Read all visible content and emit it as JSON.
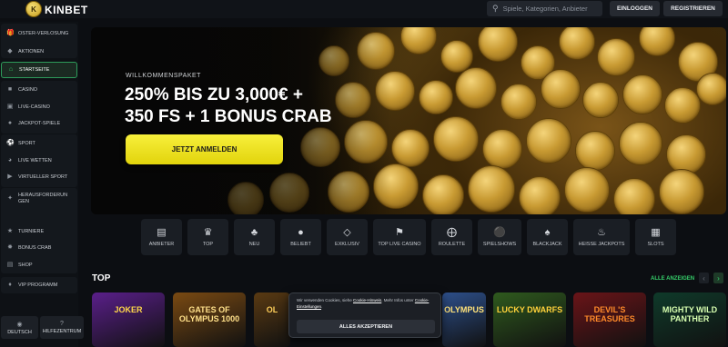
{
  "header": {
    "logo_mark": "K",
    "brand": "KINBET",
    "search_placeholder": "Spiele, Kategorien, Anbieter",
    "login_label": "EINLOGGEN",
    "register_label": "REGISTRIEREN"
  },
  "sidebar": {
    "items": [
      {
        "label": "Oster-Verlosung",
        "icon": "gift-icon"
      },
      {
        "label": "Aktionen",
        "icon": "tag-icon"
      },
      {
        "label": "Startseite",
        "icon": "home-icon",
        "active": true
      },
      {
        "label": "Casino",
        "icon": "casino-icon"
      },
      {
        "label": "Live-Casino",
        "icon": "live-casino-icon"
      },
      {
        "label": "Jackpot-Spiele",
        "icon": "jackpot-icon"
      },
      {
        "label": "Sport",
        "icon": "ball-icon"
      },
      {
        "label": "Live Wetten",
        "icon": "live-bet-icon"
      },
      {
        "label": "Virtueller Sport",
        "icon": "virtual-sport-icon"
      },
      {
        "label": "Herausforderungen",
        "icon": "challenge-icon"
      },
      {
        "label": "Turniere",
        "icon": "trophy-icon"
      },
      {
        "label": "Bonus Crab",
        "icon": "crab-icon"
      },
      {
        "label": "Shop",
        "icon": "shop-icon"
      },
      {
        "label": "VIP Programm",
        "icon": "vip-icon"
      }
    ],
    "language_label": "DEUTSCH",
    "help_label": "HILFEZENTRUM"
  },
  "hero": {
    "kicker": "WILLKOMMENSPAKET",
    "title_line1": "250% BIS ZU 3,000€ +",
    "title_line2": "350 FS + 1 BONUS CRAB",
    "cta_label": "JETZT ANMELDEN"
  },
  "categories": [
    {
      "label": "ANBIETER",
      "icon": "book-icon"
    },
    {
      "label": "TOP",
      "icon": "crown-icon"
    },
    {
      "label": "NEU",
      "icon": "clover-icon"
    },
    {
      "label": "BELIEBT",
      "icon": "bomb-icon"
    },
    {
      "label": "EXKLUSIV",
      "icon": "diamond-icon"
    },
    {
      "label": "TOP LIVE CASINO",
      "icon": "flag-icon"
    },
    {
      "label": "ROULETTE",
      "icon": "roulette-icon"
    },
    {
      "label": "SPIELSHOWS",
      "icon": "microphone-icon"
    },
    {
      "label": "BLACKJACK",
      "icon": "spade-icon"
    },
    {
      "label": "HEISSE JACKPOTS",
      "icon": "fire-icon"
    },
    {
      "label": "SLOTS",
      "icon": "slot-icon"
    }
  ],
  "top_section": {
    "title": "TOP",
    "show_all": "ALLE ANZEIGEN"
  },
  "games": [
    {
      "title": "JOKER",
      "bg": "#5a1f8a",
      "fg": "#ffd84a"
    },
    {
      "title": "GATES OF OLYMPUS 1000",
      "bg": "#7a4a12",
      "fg": "#ffe08a"
    },
    {
      "title": "OL",
      "bg": "#5a3a12",
      "fg": "#ffcf5a"
    },
    {
      "title": "OLYMPUS",
      "bg": "#2d4f8a",
      "fg": "#ffe27a"
    },
    {
      "title": "LUCKY DWARFS",
      "bg": "#2f5a1e",
      "fg": "#ffd23a"
    },
    {
      "title": "DEVIL'S TREASURES",
      "bg": "#6a1418",
      "fg": "#ff8a2a"
    },
    {
      "title": "MIGHTY WILD PANTHER",
      "bg": "#0f3a2a",
      "fg": "#d8ffb0"
    }
  ],
  "cookie": {
    "text_before": "Wir verwenden Cookies, siehe ",
    "link1": "Cookie-Hinweis",
    "text_mid": ". Mehr Infos unter ",
    "link2": "Cookie-Einstellungen",
    "text_after": ".",
    "accept_label": "ALLES AKZEPTIEREN"
  },
  "colors": {
    "accent_green": "#36d16b",
    "cta_yellow": "#f2e621",
    "background": "#0c0e12"
  }
}
